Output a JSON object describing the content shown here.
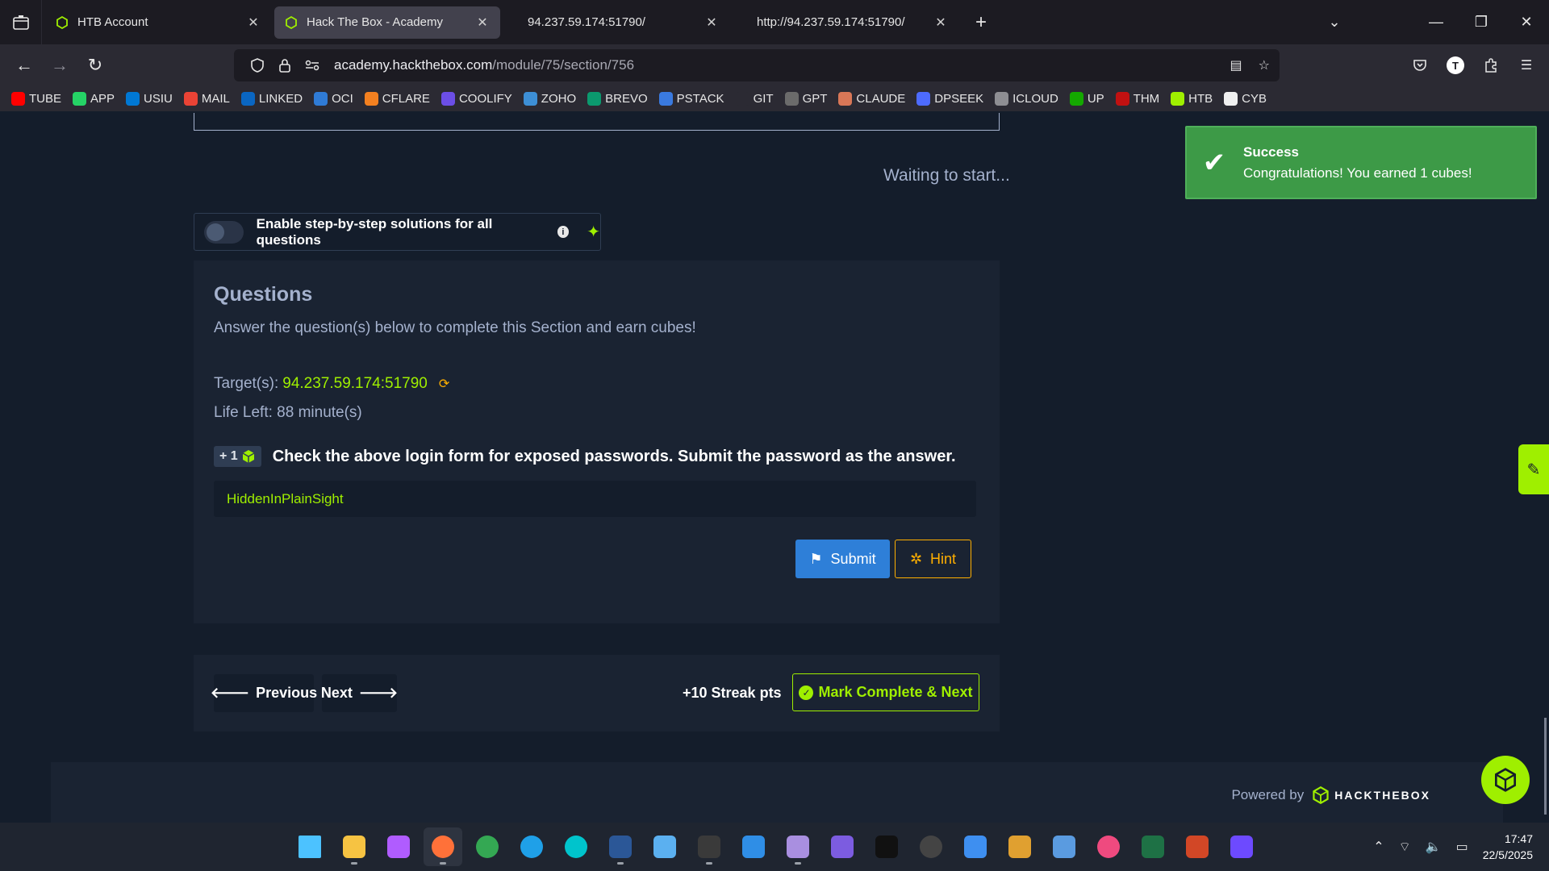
{
  "browser": {
    "tabs": [
      {
        "title": "HTB Account",
        "favicon": "htb-cube-icon",
        "active": false
      },
      {
        "title": "Hack The Box - Academy",
        "favicon": "htb-cube-icon",
        "active": true
      },
      {
        "title": "94.237.59.174:51790/",
        "favicon": "",
        "active": false
      },
      {
        "title": "http://94.237.59.174:51790/",
        "favicon": "",
        "active": false
      }
    ],
    "url_domain": "academy.hackthebox.com",
    "url_path": "/module/75/section/756",
    "bookmarks": [
      {
        "label": "TUBE",
        "color": "#ff0000"
      },
      {
        "label": "APP",
        "color": "#25d366"
      },
      {
        "label": "USIU",
        "color": "#0078d4"
      },
      {
        "label": "MAIL",
        "color": "#ea4335"
      },
      {
        "label": "LINKED",
        "color": "#0a66c2"
      },
      {
        "label": "OCI",
        "color": "#2f7bd6"
      },
      {
        "label": "CFLARE",
        "color": "#f38020"
      },
      {
        "label": "COOLIFY",
        "color": "#6b4ee6"
      },
      {
        "label": "ZOHO",
        "color": "#3d8fd6"
      },
      {
        "label": "BREVO",
        "color": "#0b996e"
      },
      {
        "label": "PSTACK",
        "color": "#3a7ae0"
      },
      {
        "label": "GIT",
        "color": "#2b2a33"
      },
      {
        "label": "GPT",
        "color": "#6b6b6b"
      },
      {
        "label": "CLAUDE",
        "color": "#d97757"
      },
      {
        "label": "DPSEEK",
        "color": "#4d6bfe"
      },
      {
        "label": "ICLOUD",
        "color": "#8e8e93"
      },
      {
        "label": "UP",
        "color": "#14a800"
      },
      {
        "label": "THM",
        "color": "#c11111"
      },
      {
        "label": "HTB",
        "color": "#9fef00"
      },
      {
        "label": "CYB",
        "color": "#f0f0f0"
      }
    ]
  },
  "page": {
    "status": "Waiting to start...",
    "toggle_label": "Enable step-by-step solutions for all questions",
    "questions_title": "Questions",
    "questions_desc": "Answer the question(s) below to complete this Section and earn cubes!",
    "target_label": "Target(s):",
    "target_ip": "94.237.59.174:51790",
    "life_left": "Life Left: 88 minute(s)",
    "badge": "+ 1",
    "question": "Check the above login form for exposed passwords. Submit the password as the answer.",
    "answer_value": "HiddenInPlainSight",
    "submit_label": "Submit",
    "hint_label": "Hint",
    "previous_label": "Previous",
    "next_label": "Next",
    "streak": "+10 Streak pts",
    "mark_complete_label": "Mark Complete & Next",
    "powered_by": "Powered by",
    "brand": "HACKTHEBOX"
  },
  "toast": {
    "title": "Success",
    "message": "Congratulations! You earned 1 cubes!"
  },
  "taskbar": {
    "time": "17:47",
    "date": "22/5/2025",
    "apps": [
      {
        "name": "windows-start-icon",
        "color": "#4cc2ff"
      },
      {
        "name": "file-explorer-icon",
        "color": "#f6c342"
      },
      {
        "name": "copilot-icon",
        "color": "#b05cff"
      },
      {
        "name": "firefox-icon",
        "color": "#ff7139"
      },
      {
        "name": "chrome-icon",
        "color": "#34a853"
      },
      {
        "name": "edge-icon",
        "color": "#1fa0e8"
      },
      {
        "name": "canva-icon",
        "color": "#00c4cc"
      },
      {
        "name": "word-icon",
        "color": "#2b5797"
      },
      {
        "name": "notepad-icon",
        "color": "#5bb0f0"
      },
      {
        "name": "terminal-icon",
        "color": "#3a3a3a"
      },
      {
        "name": "vscode-icon",
        "color": "#2f8ee6"
      },
      {
        "name": "app-purple-icon",
        "color": "#a98fe0"
      },
      {
        "name": "obsidian-icon",
        "color": "#7c5ce0"
      },
      {
        "name": "capcut-icon",
        "color": "#111111"
      },
      {
        "name": "obs-icon",
        "color": "#444444"
      },
      {
        "name": "ms-store-icon",
        "color": "#3e8ff0"
      },
      {
        "name": "todo-icon",
        "color": "#e0a030"
      },
      {
        "name": "mail-icon",
        "color": "#5a9be0"
      },
      {
        "name": "itunes-icon",
        "color": "#ef4a7f"
      },
      {
        "name": "excel-icon",
        "color": "#1e7145"
      },
      {
        "name": "powerpoint-icon",
        "color": "#d24726"
      },
      {
        "name": "proton-vpn-icon",
        "color": "#6d4aff"
      }
    ]
  }
}
